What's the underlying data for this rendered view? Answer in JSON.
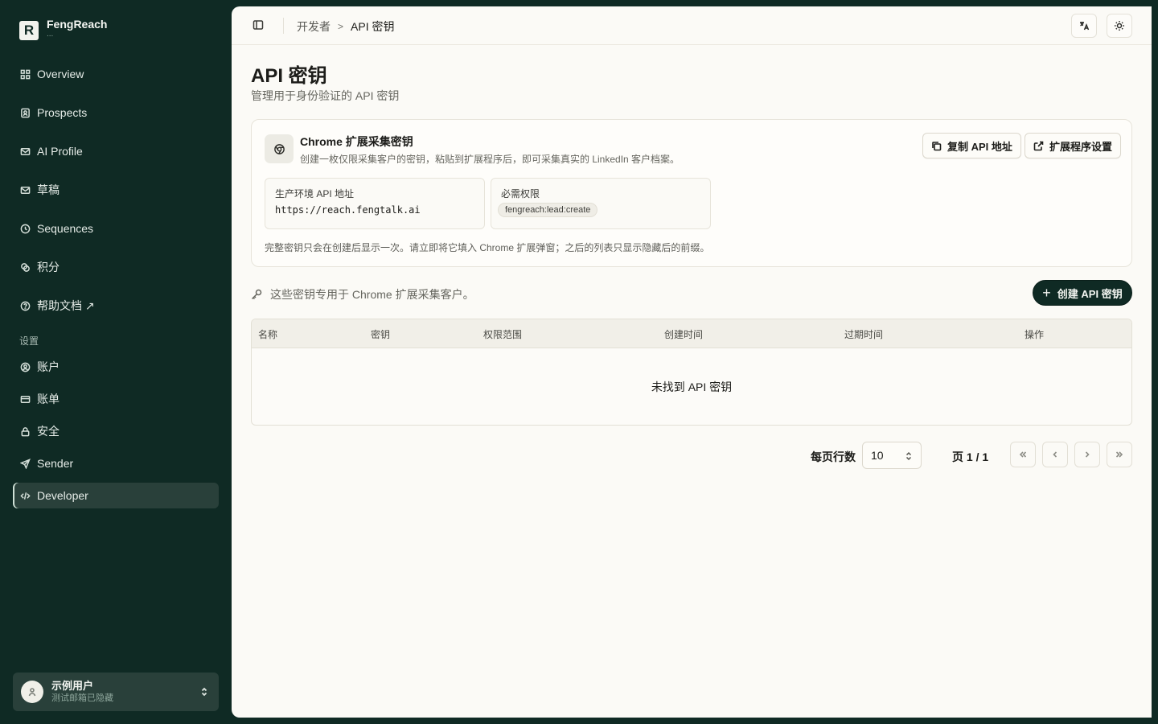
{
  "brand": {
    "name": "FengReach",
    "sub": "..."
  },
  "nav": {
    "items": [
      {
        "label": "Overview",
        "icon": "grid-icon"
      },
      {
        "label": "Prospects",
        "icon": "contact-icon"
      },
      {
        "label": "AI Profile",
        "icon": "mail-profile-icon"
      },
      {
        "label": "草稿",
        "icon": "mail-draft-icon"
      },
      {
        "label": "Sequences",
        "icon": "clock-icon"
      },
      {
        "label": "积分",
        "icon": "coins-icon"
      },
      {
        "label": "帮助文档 ↗",
        "icon": "help-icon"
      }
    ],
    "settings_heading": "设置",
    "settings_items": [
      {
        "label": "账户",
        "icon": "user-circle-icon"
      },
      {
        "label": "账单",
        "icon": "credit-card-icon"
      },
      {
        "label": "安全",
        "icon": "lock-icon"
      },
      {
        "label": "Sender",
        "icon": "send-icon"
      },
      {
        "label": "Developer",
        "icon": "code-icon"
      }
    ]
  },
  "user": {
    "name": "示例用户",
    "email": "测试邮箱已隐藏"
  },
  "breadcrumb": {
    "parent": "开发者",
    "current": "API 密钥"
  },
  "page": {
    "title": "API 密钥",
    "subtitle": "管理用于身份验证的 API 密钥"
  },
  "card": {
    "title": "Chrome 扩展采集密钥",
    "description": "创建一枚仅限采集客户的密钥，粘贴到扩展程序后，即可采集真实的 LinkedIn 客户档案。",
    "copy_button": "复制 API 地址",
    "settings_button": "扩展程序设置",
    "api_label": "生产环境 API 地址",
    "api_value": "https://reach.fengtalk.ai",
    "perm_label": "必需权限",
    "perm_value": "fengreach:lead:create",
    "note": "完整密钥只会在创建后显示一次。请立即将它填入 Chrome 扩展弹窗；之后的列表只显示隐藏后的前缀。"
  },
  "hint": "这些密钥专用于 Chrome 扩展采集客户。",
  "create_button": "创建 API 密钥",
  "table": {
    "columns": [
      "名称",
      "密钥",
      "权限范围",
      "创建时间",
      "过期时间",
      "操作"
    ],
    "empty": "未找到 API 密钥"
  },
  "pager": {
    "rows_label": "每页行数",
    "rows_value": "10",
    "page_text": "页 1 / 1"
  },
  "colors": {
    "sidebar": "#0f2a24",
    "main_bg": "#fbfaf6",
    "primary": "#0f2a24"
  }
}
